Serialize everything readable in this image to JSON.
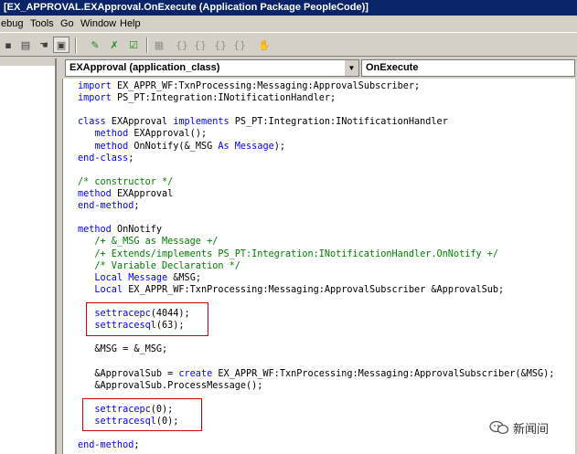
{
  "window": {
    "title": "[EX_APPROVAL.EXApproval.OnExecute (Application Package PeopleCode)]"
  },
  "menu": {
    "items": [
      "ebug",
      "Tools",
      "Go",
      "Window",
      "Help"
    ]
  },
  "selectors": {
    "object": "EXApproval   (application_class)",
    "event": "OnExecute"
  },
  "code": {
    "lines": [
      [
        [
          "kw",
          "import"
        ],
        [
          "t",
          " EX_APPR_WF:TxnProcessing:Messaging:ApprovalSubscriber;"
        ]
      ],
      [
        [
          "kw",
          "import"
        ],
        [
          "t",
          " PS_PT:Integration:INotificationHandler;"
        ]
      ],
      [],
      [
        [
          "kw",
          "class"
        ],
        [
          "t",
          " EXApproval "
        ],
        [
          "kw",
          "implements"
        ],
        [
          "t",
          " PS_PT:Integration:INotificationHandler"
        ]
      ],
      [
        [
          "t",
          "   "
        ],
        [
          "kw",
          "method"
        ],
        [
          "t",
          " EXApproval();"
        ]
      ],
      [
        [
          "t",
          "   "
        ],
        [
          "kw",
          "method"
        ],
        [
          "t",
          " OnNotify(&_MSG "
        ],
        [
          "kw",
          "As"
        ],
        [
          "t",
          " "
        ],
        [
          "kw",
          "Message"
        ],
        [
          "t",
          ");"
        ]
      ],
      [
        [
          "kw",
          "end-class"
        ],
        [
          "t",
          ";"
        ]
      ],
      [],
      [
        [
          "cm",
          "/* constructor */"
        ]
      ],
      [
        [
          "kw",
          "method"
        ],
        [
          "t",
          " EXApproval"
        ]
      ],
      [
        [
          "kw",
          "end-method"
        ],
        [
          "t",
          ";"
        ]
      ],
      [],
      [
        [
          "kw",
          "method"
        ],
        [
          "t",
          " OnNotify"
        ]
      ],
      [
        [
          "t",
          "   "
        ],
        [
          "cm",
          "/+ &_MSG as Message +/"
        ]
      ],
      [
        [
          "t",
          "   "
        ],
        [
          "cm",
          "/+ Extends/implements PS_PT:Integration:INotificationHandler.OnNotify +/"
        ]
      ],
      [
        [
          "t",
          "   "
        ],
        [
          "cm",
          "/* Variable Declaration */"
        ]
      ],
      [
        [
          "t",
          "   "
        ],
        [
          "kw",
          "Local"
        ],
        [
          "t",
          " "
        ],
        [
          "kw",
          "Message"
        ],
        [
          "t",
          " &MSG;"
        ]
      ],
      [
        [
          "t",
          "   "
        ],
        [
          "kw",
          "Local"
        ],
        [
          "t",
          " EX_APPR_WF:TxnProcessing:Messaging:ApprovalSubscriber &ApprovalSub;"
        ]
      ],
      [],
      [
        [
          "t",
          "   "
        ],
        [
          "kw",
          "settracepc"
        ],
        [
          "t",
          "(4044);"
        ]
      ],
      [
        [
          "t",
          "   "
        ],
        [
          "kw",
          "settracesql"
        ],
        [
          "t",
          "(63);"
        ]
      ],
      [],
      [
        [
          "t",
          "   &MSG = &_MSG;"
        ]
      ],
      [],
      [
        [
          "t",
          "   &ApprovalSub = "
        ],
        [
          "kw",
          "create"
        ],
        [
          "t",
          " EX_APPR_WF:TxnProcessing:Messaging:ApprovalSubscriber(&MSG);"
        ]
      ],
      [
        [
          "t",
          "   &ApprovalSub.ProcessMessage();"
        ]
      ],
      [],
      [
        [
          "t",
          "   "
        ],
        [
          "kw",
          "settracepc"
        ],
        [
          "t",
          "(0);"
        ]
      ],
      [
        [
          "t",
          "   "
        ],
        [
          "kw",
          "settracesql"
        ],
        [
          "t",
          "(0);"
        ]
      ],
      [],
      [
        [
          "kw",
          "end-method"
        ],
        [
          "t",
          ";"
        ]
      ]
    ]
  },
  "watermark": {
    "text": "新闻间"
  },
  "colors": {
    "keyword": "#0000ff",
    "comment": "#008000",
    "highlight_box": "#d00000",
    "titlebar": "#0a246a"
  }
}
